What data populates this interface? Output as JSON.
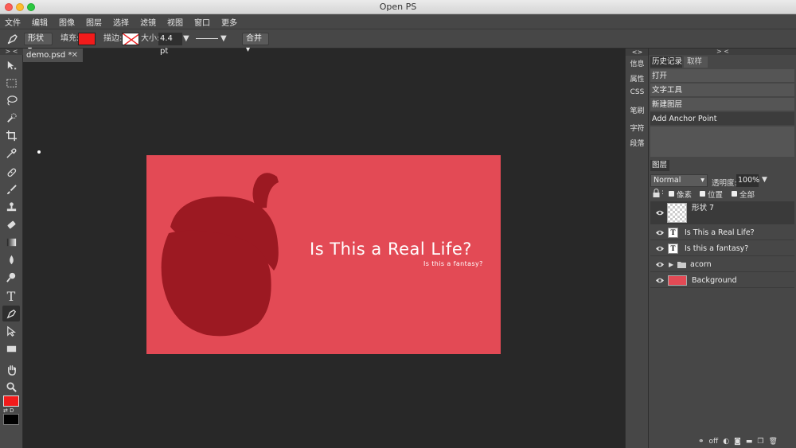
{
  "window": {
    "title": "Open PS"
  },
  "menu": [
    "文件",
    "编辑",
    "图像",
    "图层",
    "选择",
    "滤镜",
    "视图",
    "窗口",
    "更多"
  ],
  "options": {
    "shape_mode": "形状",
    "fill_label": "填充:",
    "fill_color": "#f21b1b",
    "stroke_label": "描边:",
    "size_label": "大小:",
    "size_value": "4.4 pt",
    "merge_label": "合并"
  },
  "toolbox": {
    "collapse_label": "> <",
    "foreground_color": "#f21b1b",
    "background_color": "#000000"
  },
  "document": {
    "tab_label": "demo.psd *",
    "close_glyph": "✕"
  },
  "canvas": {
    "background": "#e34a55",
    "acorn_color": "#9c1922",
    "headline": "Is This a Real Life?",
    "subline": "Is this a fantasy?"
  },
  "side_tabs": {
    "collapse_label": "<>",
    "items": [
      "信息",
      "属性",
      "CSS",
      "笔刷",
      "字符",
      "段落"
    ]
  },
  "right": {
    "collapse_label": "> <",
    "tabs": [
      "历史记录",
      "取样"
    ],
    "history": [
      "打开",
      "文字工具",
      "新建图层",
      "Add Anchor Point"
    ],
    "layers_tab": "图层",
    "blend_mode": "Normal",
    "opacity_label": "透明度:",
    "opacity_value": "100%",
    "lock_options": [
      "像素",
      "位置",
      "全部"
    ],
    "layers": [
      {
        "name": "形状 7",
        "kind": "shape"
      },
      {
        "name": "Is This a Real Life?",
        "kind": "text",
        "icon": "T"
      },
      {
        "name": "Is this a fantasy?",
        "kind": "text",
        "icon": "T"
      },
      {
        "name": "acorn",
        "kind": "folder"
      },
      {
        "name": "Background",
        "kind": "raster"
      }
    ],
    "footer_off": "off"
  }
}
